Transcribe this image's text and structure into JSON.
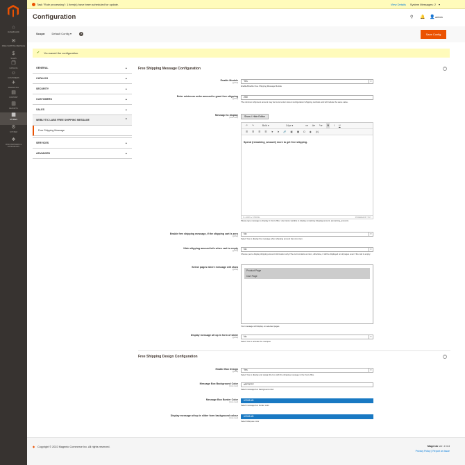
{
  "menu": [
    {
      "id": "dashboard",
      "label": "Dashboard",
      "icon": "⌂"
    },
    {
      "id": "free-shipping",
      "label": "Free Shipping Message",
      "icon": "✉"
    },
    {
      "id": "sales",
      "label": "Sales",
      "icon": "$"
    },
    {
      "id": "catalog",
      "label": "Catalog",
      "icon": "❒"
    },
    {
      "id": "customers",
      "label": "Customers",
      "icon": "☺"
    },
    {
      "id": "marketing",
      "label": "Marketing",
      "icon": "✈"
    },
    {
      "id": "content",
      "label": "Content",
      "icon": "▤"
    },
    {
      "id": "reports",
      "label": "Reports",
      "icon": "▥"
    },
    {
      "id": "stores",
      "label": "Stores",
      "icon": "▦"
    },
    {
      "id": "system",
      "label": "System",
      "icon": "⚙"
    },
    {
      "id": "partners",
      "label": "Find Partners & Extensions",
      "icon": "❖"
    }
  ],
  "notice": {
    "text": "Task \"Rule processing\": 1 item(s) have been scheduled for update.",
    "view_details": "View Details",
    "system_messages": "System Messages: 2"
  },
  "page": {
    "title": "Configuration",
    "user": "admin"
  },
  "scope": {
    "label": "Scope:",
    "value": "Default Config",
    "help": "?"
  },
  "save_label": "Save Config",
  "success_msg": "You saved the configuration.",
  "tabs": [
    "GENERAL",
    "CATALOG",
    "SECURITY",
    "CUSTOMERS",
    "SALES",
    "WEBLYTIC LABS FREE SHIPPING MESSAGE",
    "SERVICES",
    "ADVANCED"
  ],
  "subtab": "Free Shipping Message",
  "section1": {
    "title": "Free Shipping Message Configuration",
    "enable": {
      "label": "Enable Module",
      "scope": "[global]",
      "value": "Yes",
      "note": "Enable/Disable Free Shipping Message Module"
    },
    "min_amount": {
      "label": "Enter minimum order amount to grant free shipping",
      "scope": "[global]",
      "value": "250",
      "note": "The minimum shipment amount may be found under stores>configuration>shipping methods and will include the same value."
    },
    "message": {
      "label": "Message to display",
      "scope": "[store view]",
      "toggle": "Show / Hide Editor",
      "font": "Bold",
      "size": "14px",
      "content": "Spend {remaining_amount} more to get free shipping.",
      "path": "P » SPAN » STRONG",
      "powered": "POWERED BY TINY",
      "note": "Please type message to display in front office. Use below variable to display remaining shipping amount. {remaining_amount}"
    },
    "zero_cart": {
      "label": "Enable free shipping message, if the shipping cart is zero",
      "scope": "[global]",
      "value": "No",
      "note": "Select Yes to display the message when shipping amount has zero item."
    },
    "hide_info": {
      "label": "Hide shipping amount info when cart is empty",
      "scope": "[global]",
      "value": "No",
      "note": "Choose yes to display shipping amount information only if the cart contains an item, otherwise, it will be displayed on all pages even if the cart is empty."
    },
    "pages": {
      "label": "Select pages where message will show",
      "scope": "[global]",
      "options": [
        "Product Page",
        "Cart Page"
      ],
      "note": "Your message will display on selected pages"
    },
    "slider": {
      "label": "Display message at top in form of slider",
      "scope": "[global]",
      "value": "No",
      "note": "Select Yes to activate the marquee"
    }
  },
  "section2": {
    "title": "Free Shipping Design Configuration",
    "enable_box": {
      "label": "Enable Box Design",
      "scope": "[global]",
      "value": "Yes",
      "note": "Select Yes to display and design the box with the shipping message in the front office."
    },
    "bg": {
      "label": "Message Box Background Color",
      "scope": "[store view]",
      "value": "#FFFFFF",
      "note": "Select message box background color"
    },
    "border": {
      "label": "Message Box Border Color",
      "scope": "[store view]",
      "value": "#2961AB",
      "note": "Select message box border color"
    },
    "slider_bg": {
      "label": "Display message at top in slider form background colour",
      "scope": "[store view]",
      "value": "#2961AB",
      "note": "Select Marquee color"
    }
  },
  "footer": {
    "copyright": "Copyright © 2022 Magento Commerce Inc. All rights reserved.",
    "brand": "Magento",
    "version": "ver. 2.4.4",
    "privacy": "Privacy Policy",
    "report": "Report an Issue"
  },
  "colors": {
    "accent": "#eb5202",
    "menu": "#373330",
    "link": "#007bdb",
    "swatch": "#1979c3"
  }
}
